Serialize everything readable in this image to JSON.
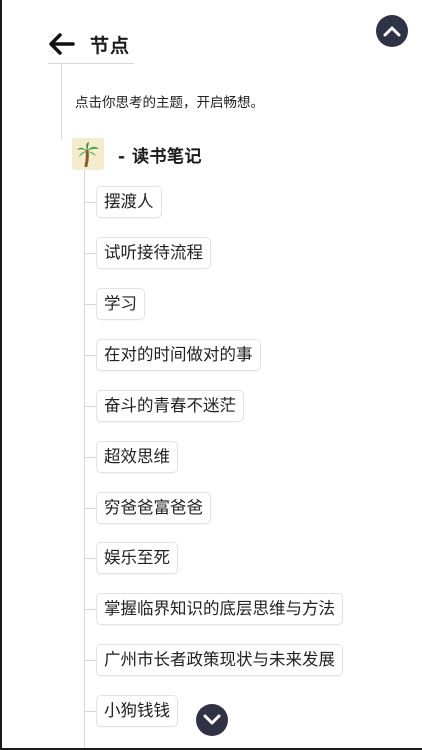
{
  "header": {
    "title": "节点",
    "back_icon": "arrow-left-icon"
  },
  "hint": "点击你思考的主题，开启畅想。",
  "root": {
    "icon": "palm-tree-icon",
    "title": "- 读书笔记"
  },
  "children": [
    {
      "label": "摆渡人"
    },
    {
      "label": "试听接待流程"
    },
    {
      "label": "学习"
    },
    {
      "label": "在对的时间做对的事"
    },
    {
      "label": "奋斗的青春不迷茫"
    },
    {
      "label": "超效思维"
    },
    {
      "label": "穷爸爸富爸爸"
    },
    {
      "label": "娱乐至死"
    },
    {
      "label": "掌握临界知识的底层思维与方法"
    },
    {
      "label": "广州市长者政策现状与未来发展"
    },
    {
      "label": "小狗钱钱"
    }
  ],
  "controls": {
    "scroll_top_icon": "chevron-up-icon",
    "scroll_down_icon": "chevron-down-icon"
  },
  "colors": {
    "fab_bg": "#2f3345",
    "chip_border": "#e2e2e2",
    "tree_line": "#d8d8d8",
    "root_icon_bg": "#f4eccd"
  }
}
